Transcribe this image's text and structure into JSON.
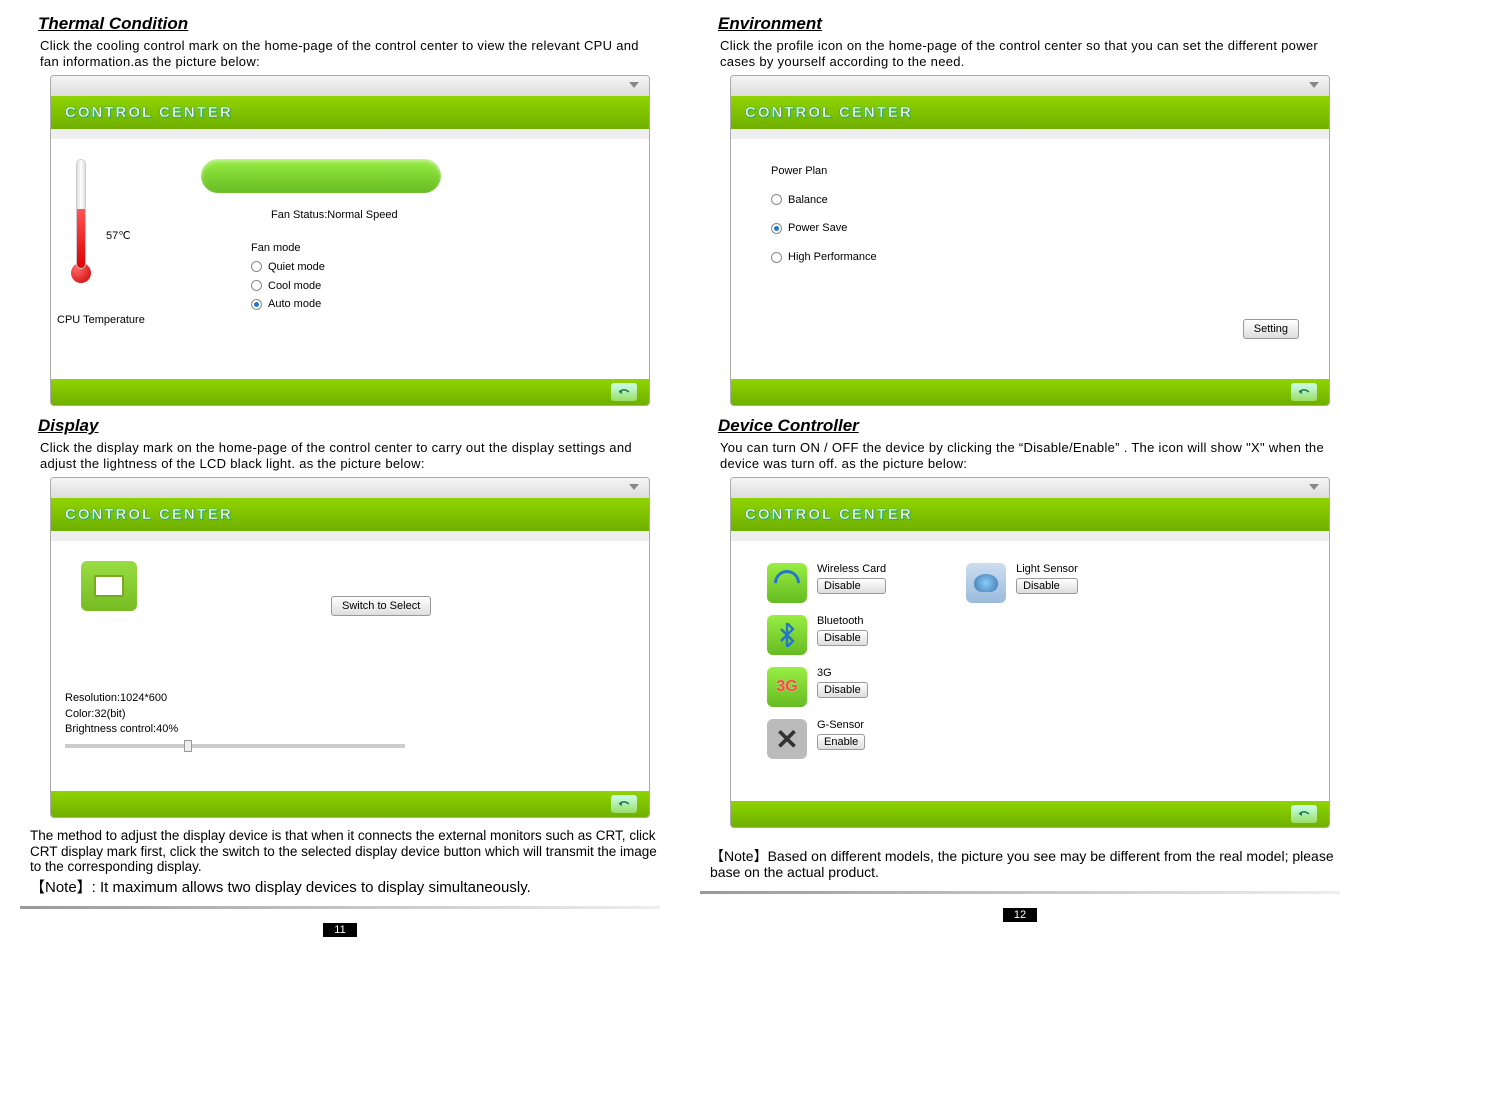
{
  "left": {
    "thermal": {
      "title": "Thermal Condition",
      "desc": "Click the cooling control mark on the home-page of the control center to view the relevant CPU and fan information.as the picture below:",
      "banner": "CONTROL CENTER",
      "temp_value": "57℃",
      "cpu_temp_label": "CPU Temperature",
      "fan_status": "Fan Status:Normal Speed",
      "fan_mode_label": "Fan mode",
      "quiet": "Quiet mode",
      "cool": "Cool mode",
      "auto": "Auto mode"
    },
    "display": {
      "title": "Display",
      "desc": "Click the display mark on the home-page of the control center to carry out the display settings and adjust the lightness of the LCD black light. as the picture below:",
      "banner": "CONTROL CENTER",
      "switch_btn": "Switch to Select",
      "resolution": "Resolution:1024*600",
      "color": "Color:32(bit)",
      "brightness": "Brightness control:40%"
    },
    "method_text": "The method to adjust the display device is that when it connects the external monitors such as CRT, click CRT display mark first, click the switch to the selected display device  button which will transmit the image to the corresponding display.",
    "note_text": "【Note】: It maximum allows two display devices to display simultaneously.",
    "page_num": "11"
  },
  "right": {
    "environment": {
      "title": "Environment",
      "desc": "Click the profile icon on the home-page of the control center so that you can  set the different power cases by yourself according to the need.",
      "banner": "CONTROL CENTER",
      "plan_label": "Power Plan",
      "balance": "Balance",
      "power_save": "Power Save",
      "high_perf": "High Performance",
      "setting_btn": "Setting"
    },
    "device": {
      "title": "Device Controller",
      "desc": "You can turn ON / OFF the device by clicking the “Disable/Enable” . The icon will show \"X\" when the device was turn off. as the picture below:",
      "banner": "CONTROL CENTER",
      "wireless": "Wireless Card",
      "bluetooth": "Bluetooth",
      "g3": "3G",
      "gsensor": "G-Sensor",
      "light": "Light Sensor",
      "disable": "Disable",
      "enable": "Enable"
    },
    "note_text": "【Note】Based on different models, the picture you see may  be different from the real model; please base on the actual product.",
    "page_num": "12"
  }
}
